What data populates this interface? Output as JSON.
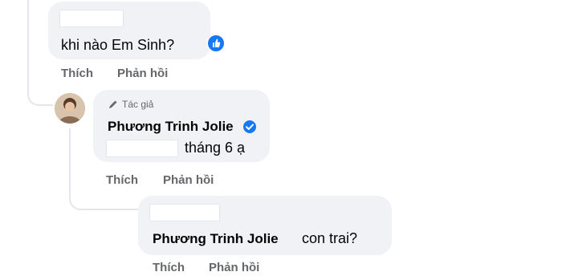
{
  "comment1": {
    "text": "khi nào Em Sinh?",
    "reaction_icon": "like-icon",
    "actions": {
      "like": "Thích",
      "reply": "Phản hồi"
    }
  },
  "comment2": {
    "badge": "Tác giả",
    "badge_icon": "pencil-icon",
    "author": "Phương Trinh Jolie",
    "verified_icon": "verified-badge-icon",
    "text": "tháng 6 ạ",
    "actions": {
      "like": "Thích",
      "reply": "Phản hồi"
    }
  },
  "comment3": {
    "mention": "Phương Trinh Jolie",
    "text": "con trai?",
    "actions": {
      "like": "Thích",
      "reply": "Phản hồi"
    }
  },
  "colors": {
    "bubble": "#f0f2f5",
    "secondary_text": "#65676b",
    "facebook_blue": "#1877f2"
  }
}
